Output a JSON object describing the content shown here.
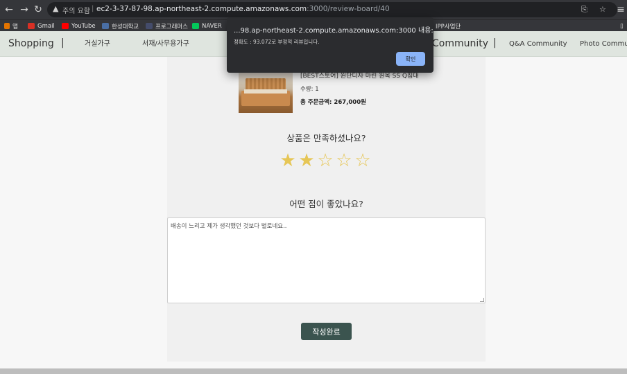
{
  "browser": {
    "warning_text": "주의 요함",
    "url_host": "ec2-3-37-87-98.ap-northeast-2.compute.amazonaws.com",
    "url_path": ":3000/review-board/40"
  },
  "bookmarks": [
    {
      "label": "앱",
      "color": "#5f6368"
    },
    {
      "label": "Gmail",
      "color": "#d93025"
    },
    {
      "label": "YouTube",
      "color": "#ff0000"
    },
    {
      "label": "한성대학교",
      "color": "#4a6fa5"
    },
    {
      "label": "프로그래머스",
      "color": "#444c6b"
    },
    {
      "label": "NAVER",
      "color": "#03c75a"
    },
    {
      "label": "IPP사업단",
      "color": "#5f6368"
    }
  ],
  "nav": {
    "shopping": "Shopping",
    "living": "거실가구",
    "study": "서재/사무용가구",
    "community": "Community",
    "qa": "Q&A Community",
    "photo": "Photo Community"
  },
  "product": {
    "name": "[BEST스토어] 원단디자 마린 원목 SS Q침대",
    "quantity": "수량: 1",
    "total": "총 주문금액: 267,000원"
  },
  "review": {
    "question_satisfaction": "상품은 만족하셨나요?",
    "rating": 2,
    "rating_max": 5,
    "question_good_points": "어떤 점이 좋았나요?",
    "text": "배송이 느리고 제가 생각했던 것보다 별로네요..",
    "submit_label": "작성완료"
  },
  "dialog": {
    "title": "...98.ap-northeast-2.compute.amazonaws.com:3000 내용:",
    "message": "정확도 : 93.072로 부정적 리뷰입니다.",
    "ok_label": "확인"
  },
  "colors": {
    "accent_button": "#3b544f",
    "star": "#e6c656",
    "nav_bg": "#dfe5df",
    "dialog_button": "#8ab4f8"
  }
}
